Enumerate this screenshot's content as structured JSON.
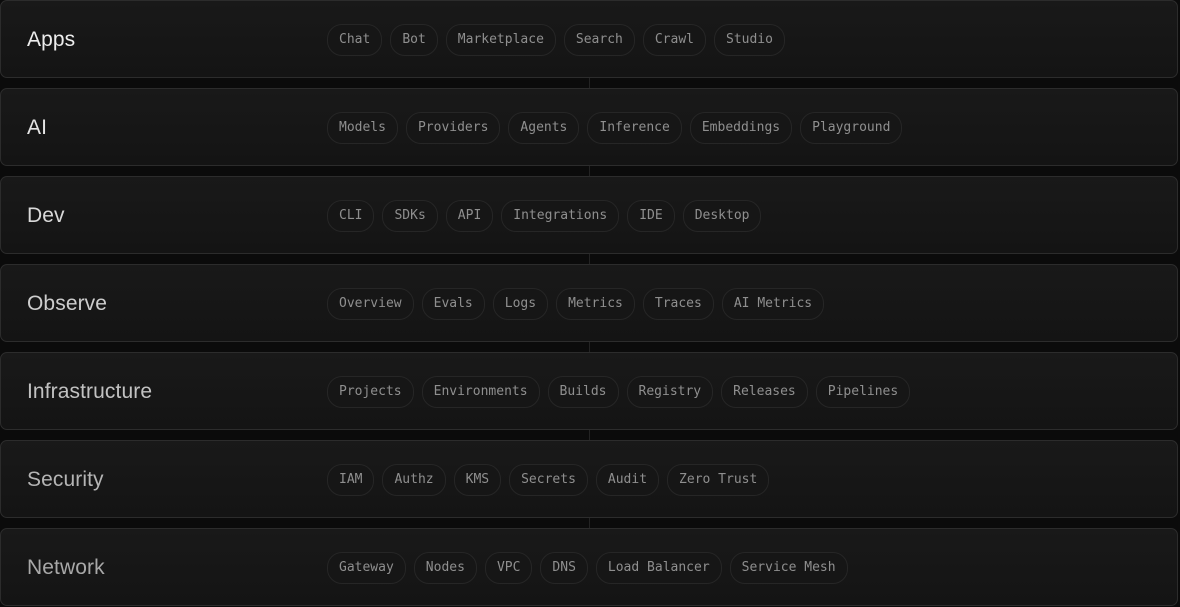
{
  "rows": [
    {
      "title": "Apps",
      "title_color": "#ededed",
      "items": [
        "Chat",
        "Bot",
        "Marketplace",
        "Search",
        "Crawl",
        "Studio"
      ]
    },
    {
      "title": "AI",
      "title_color": "#e4e4e4",
      "items": [
        "Models",
        "Providers",
        "Agents",
        "Inference",
        "Embeddings",
        "Playground"
      ]
    },
    {
      "title": "Dev",
      "title_color": "#d9d9d9",
      "items": [
        "CLI",
        "SDKs",
        "API",
        "Integrations",
        "IDE",
        "Desktop"
      ]
    },
    {
      "title": "Observe",
      "title_color": "#cdcdcd",
      "items": [
        "Overview",
        "Evals",
        "Logs",
        "Metrics",
        "Traces",
        "AI Metrics"
      ]
    },
    {
      "title": "Infrastructure",
      "title_color": "#c2c2c2",
      "items": [
        "Projects",
        "Environments",
        "Builds",
        "Registry",
        "Releases",
        "Pipelines"
      ]
    },
    {
      "title": "Security",
      "title_color": "#b4b4b4",
      "items": [
        "IAM",
        "Authz",
        "KMS",
        "Secrets",
        "Audit",
        "Zero Trust"
      ]
    },
    {
      "title": "Network",
      "title_color": "#a8a8a8",
      "items": [
        "Gateway",
        "Nodes",
        "VPC",
        "DNS",
        "Load Balancer",
        "Service Mesh"
      ]
    }
  ]
}
